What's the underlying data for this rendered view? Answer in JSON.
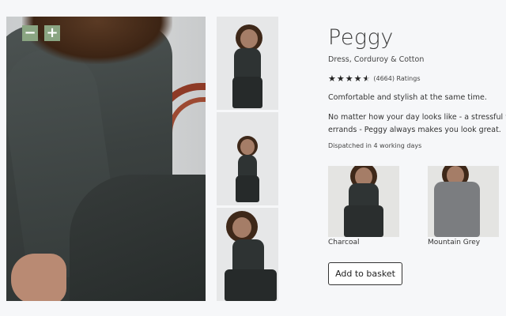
{
  "product": {
    "title": "Peggy",
    "subtitle": "Dress, Corduroy & Cotton",
    "rating_text": "(4664) Ratings",
    "stars": 4.5,
    "tagline": "Comfortable and stylish at the same time.",
    "description_lines": [
      "No matter how your day looks like - a stressful workday or",
      "errands - Peggy always makes you look great."
    ],
    "dispatch": "Dispatched in 4 working days"
  },
  "zoom": {
    "out_label": "−",
    "in_label": "+"
  },
  "variants": [
    {
      "label": "Charcoal",
      "color": "#2f3434"
    },
    {
      "label": "Mountain Grey",
      "color": "#7b7d80"
    }
  ],
  "actions": {
    "add_to_basket": "Add to basket"
  }
}
